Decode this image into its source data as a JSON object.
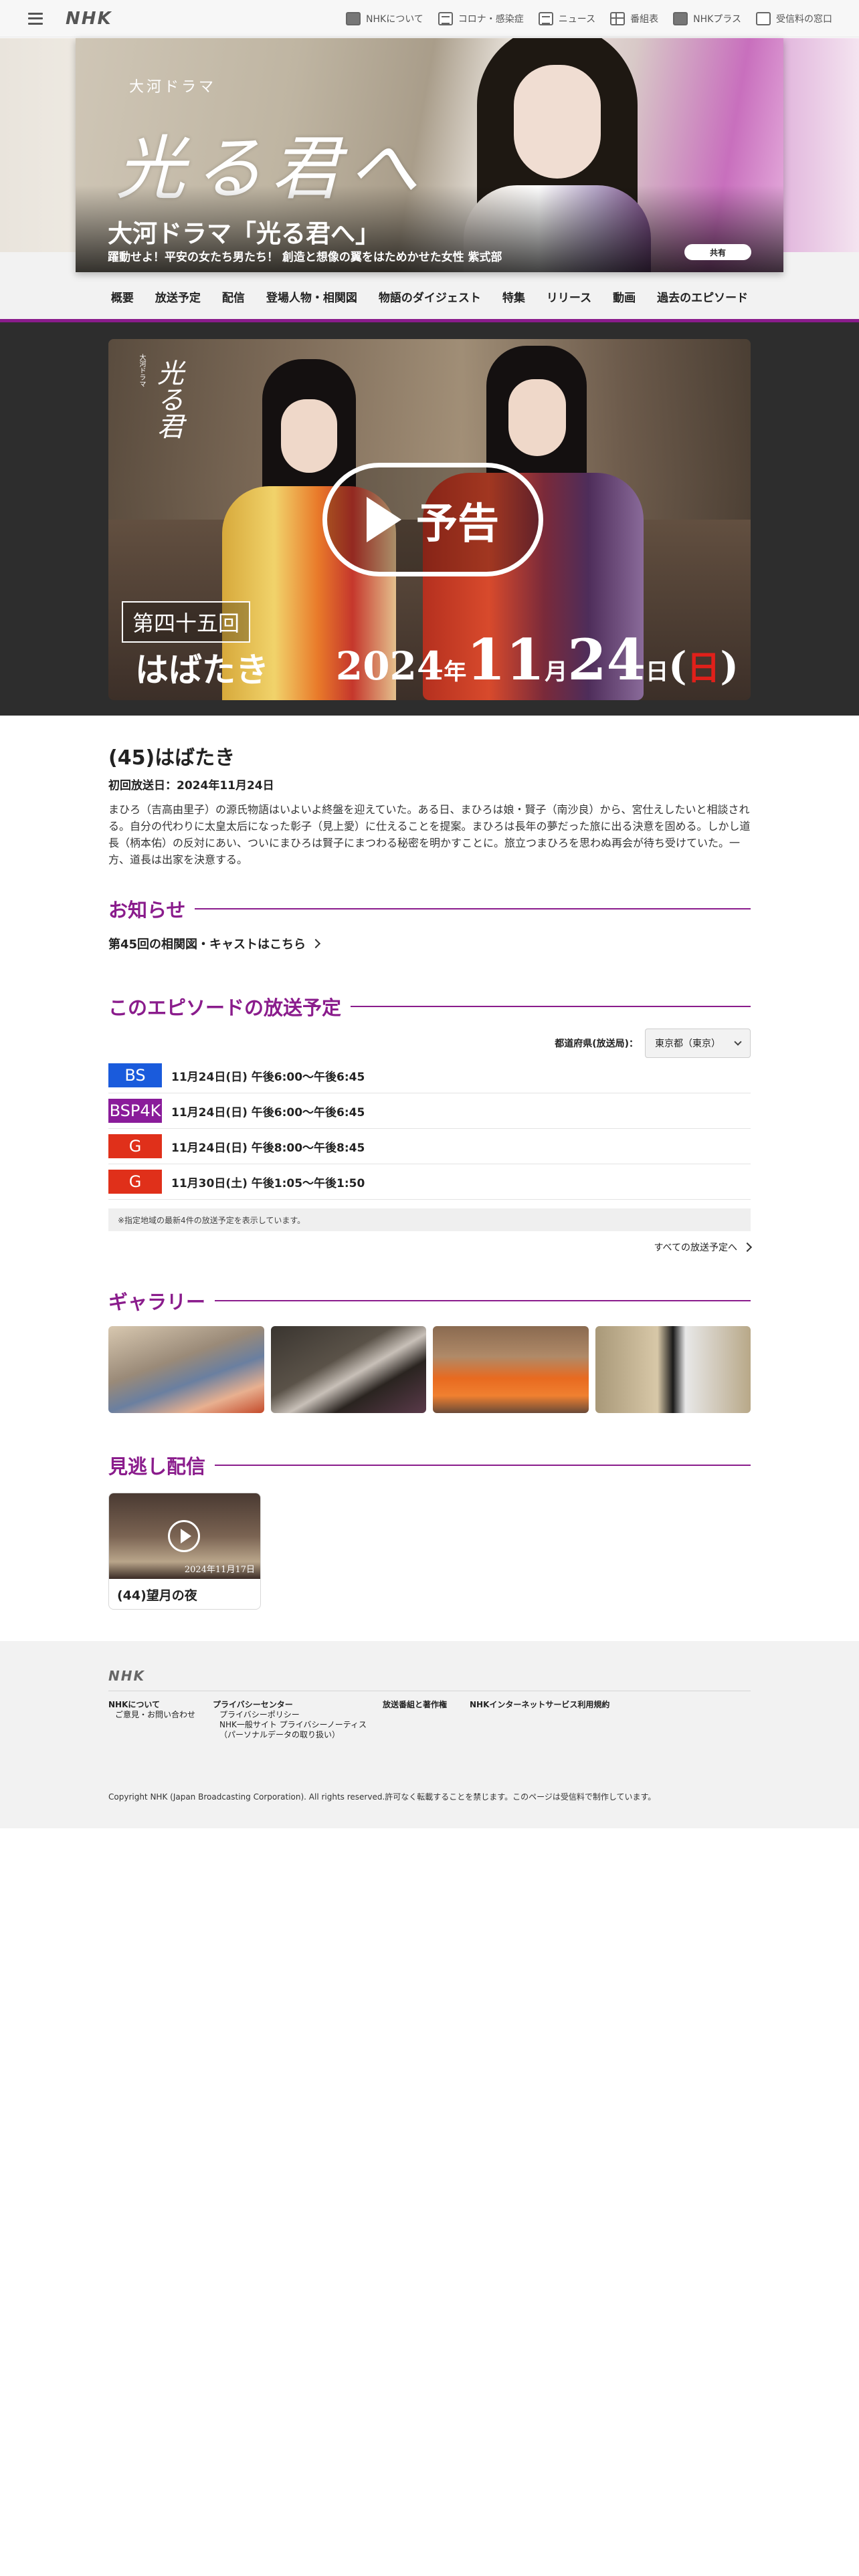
{
  "topbar": {
    "logo": "NHK",
    "links": [
      {
        "label": "NHKについて",
        "icon": "nhk-icon"
      },
      {
        "label": "コロナ・感染症",
        "icon": "document-icon"
      },
      {
        "label": "ニュース",
        "icon": "news-icon"
      },
      {
        "label": "番組表",
        "icon": "grid-icon"
      },
      {
        "label": "NHKプラス",
        "icon": "tv-icon"
      },
      {
        "label": "受信料の窓口",
        "icon": "monitor-icon"
      }
    ]
  },
  "hero": {
    "calligraphy_sub": "大河ドラマ",
    "calligraphy": "光る君へ",
    "title": "大河ドラマ「光る君へ」",
    "subtitle": "躍動せよ！平安の女たち男たち！ 創造と想像の翼をはためかせた女性 紫式部",
    "share": "共有"
  },
  "nav": [
    "概要",
    "放送予定",
    "配信",
    "登場人物・相関図",
    "物語のダイジェスト",
    "特集",
    "リリース",
    "動画",
    "過去のエピソード"
  ],
  "video": {
    "calligraphy_sub": "大河ドラマ",
    "calligraphy": "光る君",
    "play_label": "予告",
    "episode_label": "第四十五回",
    "episode_title": "はばたき",
    "date_year": "2024",
    "date_year_unit": "年",
    "date_month": "11",
    "date_month_unit": "月",
    "date_day": "24",
    "date_day_unit": "日",
    "date_weekday": "日"
  },
  "episode": {
    "heading": "(45)はばたき",
    "first_air": "初回放送日：2024年11月24日",
    "synopsis": "まひろ（吉高由里子）の源氏物語はいよいよ終盤を迎えていた。ある日、まひろは娘・賢子（南沙良）から、宮仕えしたいと相談される。自分の代わりに太皇太后になった彰子（見上愛）に仕えることを提案。まひろは長年の夢だった旅に出る決意を固める。しかし道長（柄本佑）の反対にあい、ついにまひろは賢子にまつわる秘密を明かすことに。旅立つまひろを思わぬ再会が待ち受けていた。一方、道長は出家を決意する。"
  },
  "notice": {
    "heading": "お知らせ",
    "link": "第45回の相関図・キャストはこちら"
  },
  "schedule": {
    "heading": "このエピソードの放送予定",
    "pref_label": "都道府県(放送局)：",
    "pref_value": "東京都（東京）",
    "rows": [
      {
        "channel": "BS",
        "color": "#1a5bdc",
        "time": "11月24日(日) 午後6:00〜午後6:45"
      },
      {
        "channel": "BSP4K",
        "color": "#8a1c9a",
        "time": "11月24日(日) 午後6:00〜午後6:45"
      },
      {
        "channel": "G",
        "color": "#e0301a",
        "time": "11月24日(日) 午後8:00〜午後8:45"
      },
      {
        "channel": "G",
        "color": "#e0301a",
        "time": "11月30日(土) 午後1:05〜午後1:50"
      }
    ],
    "note": "※指定地域の最新4件の放送予定を表示しています。",
    "all_link": "すべての放送予定へ"
  },
  "gallery": {
    "heading": "ギャラリー"
  },
  "missed": {
    "heading": "見逃し配信",
    "card_title": "(44)望月の夜",
    "card_date": "2024年11月17日"
  },
  "footer": {
    "logo": "NHK",
    "col1": [
      "NHKについて",
      "ご意見・お問い合わせ"
    ],
    "col2": [
      "プライバシーセンター",
      "プライバシーポリシー",
      "NHK一般サイト プライバシーノーティス",
      "（パーソナルデータの取り扱い）"
    ],
    "col3": "放送番組と著作権",
    "col4": "NHKインターネットサービス利用規約",
    "copyright": "Copyright NHK (Japan Broadcasting Corporation). All rights reserved.許可なく転載することを禁じます。このページは受信料で制作しています。"
  },
  "colors": {
    "accent": "#8a1c8c",
    "text": "#222222"
  }
}
